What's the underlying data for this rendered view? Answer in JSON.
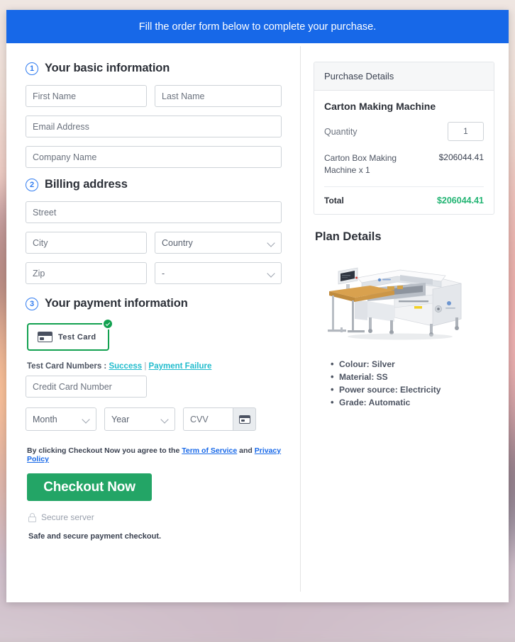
{
  "banner": {
    "text": "Fill the order form below to complete your purchase."
  },
  "sections": {
    "basic": {
      "number": "1",
      "title": "Your basic information",
      "first_name_placeholder": "First Name",
      "last_name_placeholder": "Last Name",
      "email_placeholder": "Email Address",
      "company_placeholder": "Company Name",
      "first_name_value": "",
      "last_name_value": "",
      "email_value": "",
      "company_value": ""
    },
    "billing": {
      "number": "2",
      "title": "Billing address",
      "street_placeholder": "Street",
      "city_placeholder": "City",
      "zip_placeholder": "Zip",
      "country_selected": "Country",
      "state_selected": "-",
      "street_value": "",
      "city_value": "",
      "zip_value": ""
    },
    "payment": {
      "number": "3",
      "title": "Your payment information",
      "test_card_label": "Test  Card",
      "test_card_selected": true,
      "test_numbers_prefix": "Test Card Numbers : ",
      "test_numbers_success": "Success",
      "test_numbers_separator": " | ",
      "test_numbers_failure": "Payment Failure",
      "card_number_placeholder": "Credit Card Number",
      "card_number_value": "",
      "month_selected": "Month",
      "year_selected": "Year",
      "cvv_placeholder": "CVV",
      "cvv_value": "",
      "terms_prefix": "By clicking Checkout Now you agree to the ",
      "terms_link_1": "Term of Service",
      "terms_middle": " and ",
      "terms_link_2": "Privacy Policy",
      "checkout_label": "Checkout Now",
      "secure_server_text": "Secure server",
      "safe_note": "Safe and secure payment checkout."
    }
  },
  "purchase": {
    "panel_title": "Purchase Details",
    "product_name": "Carton Making Machine",
    "quantity_label": "Quantity",
    "quantity_value": "1",
    "line_item_name": "Carton Box Making Machine x 1",
    "line_item_price": "$206044.41",
    "total_label": "Total",
    "total_value": "$206044.41"
  },
  "plan": {
    "title": "Plan Details",
    "specs": [
      "Colour: Silver",
      "Material: SS",
      "Power source: Electricity",
      "Grade: Automatic"
    ]
  },
  "colors": {
    "banner_blue": "#1768e8",
    "accent_blue": "#2f7bf0",
    "link_teal": "#21bccd",
    "success_green": "#12a150",
    "checkout_green": "#23a566",
    "total_green": "#22b473"
  }
}
